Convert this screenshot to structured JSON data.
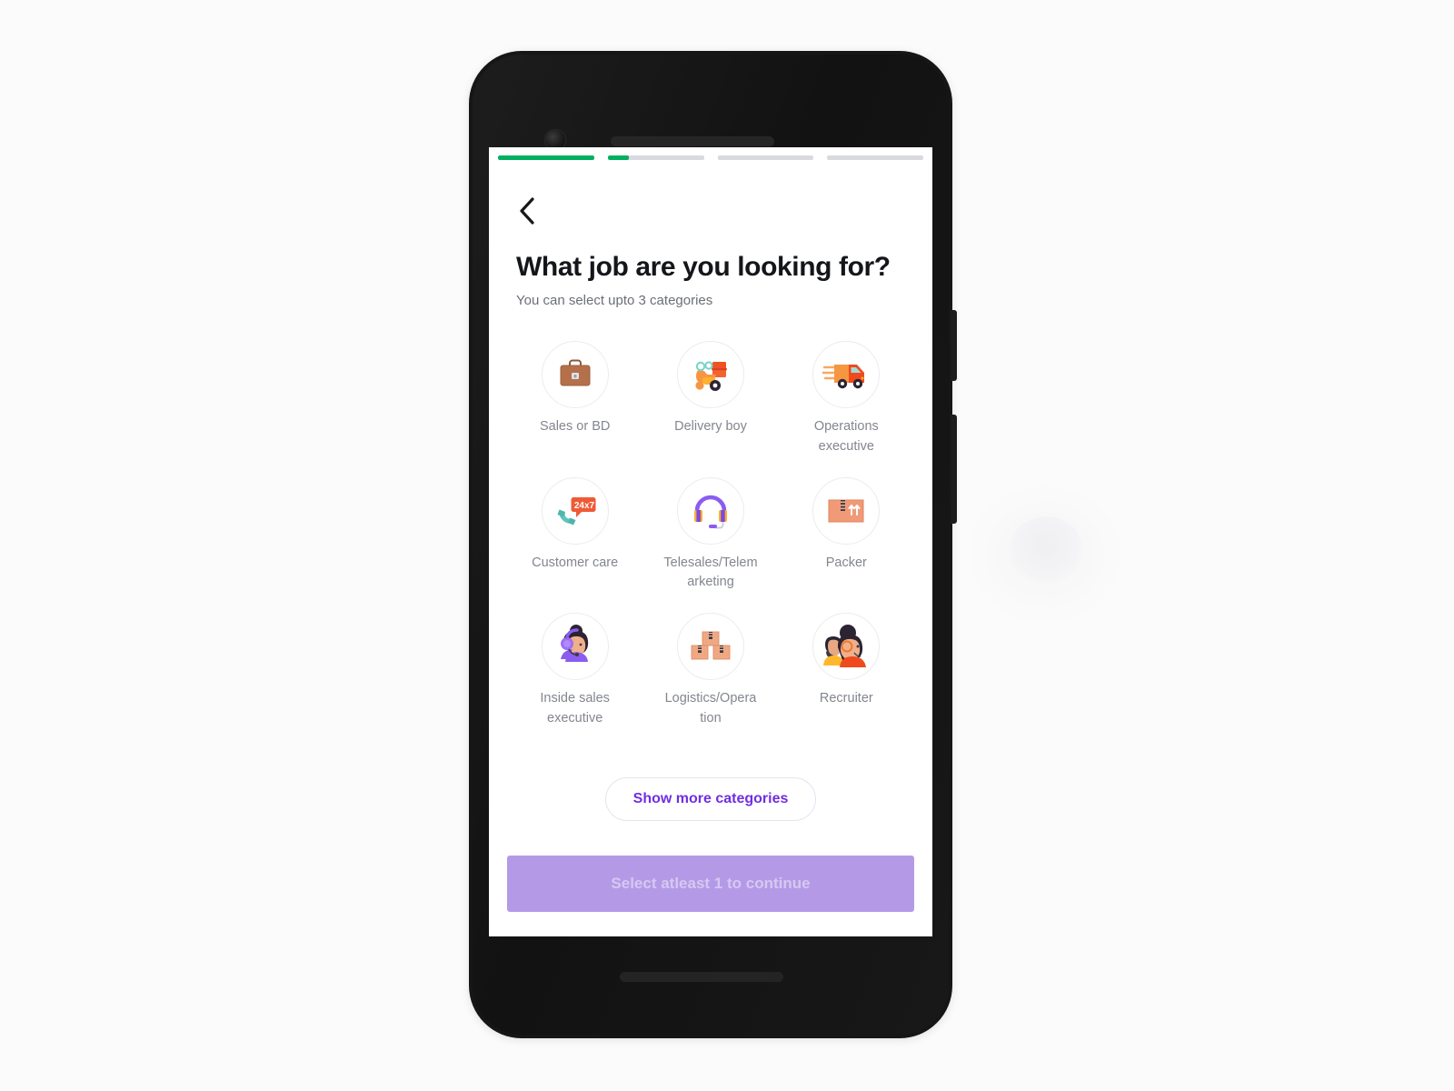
{
  "screen": {
    "progress": {
      "name": "onboarding-progress",
      "segments": [
        100,
        22,
        0,
        0
      ],
      "active_color": "#00b060",
      "track_color": "#d8dadf"
    },
    "back_label": "Back",
    "title": "What job are you looking for?",
    "subtitle": "You can select upto 3 categories",
    "categories": [
      {
        "label": "Sales or BD",
        "icon": "briefcase-icon"
      },
      {
        "label": "Delivery boy",
        "icon": "scooter-icon"
      },
      {
        "label": "Operations executive",
        "icon": "delivery-truck-icon"
      },
      {
        "label": "Customer care",
        "icon": "phone-24x7-icon"
      },
      {
        "label": "Telesales/Telemarketing",
        "icon": "headset-icon"
      },
      {
        "label": "Packer",
        "icon": "package-box-icon"
      },
      {
        "label": "Inside sales executive",
        "icon": "woman-headset-icon"
      },
      {
        "label": "Logistics/Operation",
        "icon": "stacked-boxes-icon"
      },
      {
        "label": "Recruiter",
        "icon": "two-people-icon"
      }
    ],
    "show_more_label": "Show more categories",
    "cta_label": "Select atleast 1 to continue",
    "cta_enabled": false,
    "colors": {
      "accent_purple": "#6f2fe0",
      "cta_disabled_bg": "#b49ae6",
      "cta_disabled_text": "#d6c8f2",
      "title_text": "#14161a",
      "label_text": "#83868f",
      "progress_green": "#00b060"
    }
  }
}
